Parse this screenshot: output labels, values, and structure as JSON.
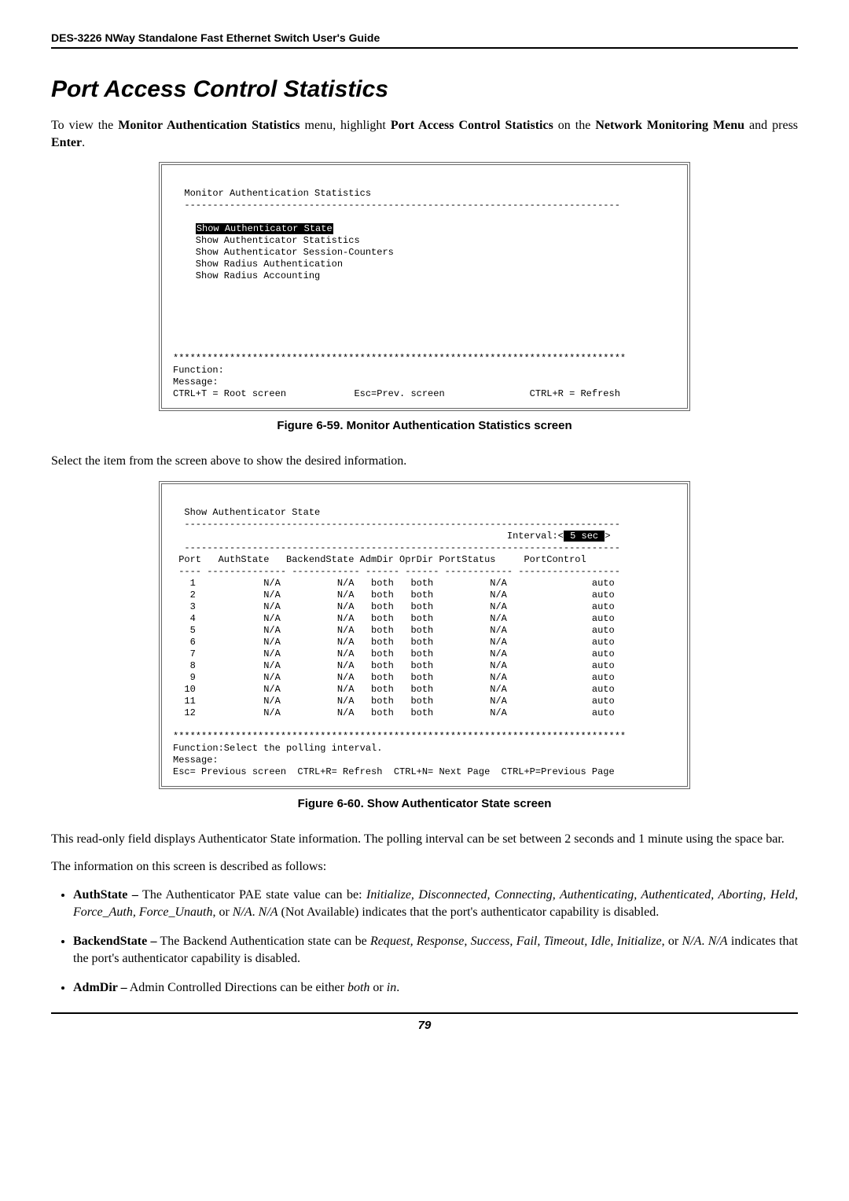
{
  "header": "DES-3226 NWay Standalone Fast Ethernet Switch User's Guide",
  "title": "Port Access Control Statistics",
  "intro": {
    "p1_a": "To view the ",
    "p1_b": "Monitor Authentication Statistics",
    "p1_c": " menu, highlight ",
    "p1_d": "Port Access Control Statistics",
    "p1_e": " on the ",
    "p1_f": "Network Monitoring Menu",
    "p1_g": " and press ",
    "p1_h": "Enter",
    "p1_i": "."
  },
  "term1": {
    "title": "Monitor Authentication Statistics",
    "rule": "  -----------------------------------------------------------------------------",
    "opt1": "Show Authenticator State",
    "opt2": "    Show Authenticator Statistics",
    "opt3": "    Show Authenticator Session-Counters",
    "opt4": "    Show Radius Authentication",
    "opt5": "    Show Radius Accounting",
    "stars": "********************************************************************************",
    "func": "Function:",
    "msg": "Message:",
    "nav": "CTRL+T = Root screen            Esc=Prev. screen               CTRL+R = Refresh"
  },
  "caption1": "Figure 6-59.  Monitor Authentication Statistics screen",
  "mid": "Select the item from the screen above to show the desired information.",
  "term2": {
    "title": "  Show Authenticator State",
    "rule1": "  -----------------------------------------------------------------------------",
    "interval_a": "                                                           Interval:<",
    "interval_b": " 5 sec ",
    "interval_c": ">",
    "rule2": "  -----------------------------------------------------------------------------",
    "hdr": " Port   AuthState   BackendState AdmDir OprDir PortStatus     PortControl",
    "rule3": " ---- -------------- ------------ ------ ------ ------------ ------------------",
    "r1": "   1            N/A          N/A   both   both          N/A               auto",
    "r2": "   2            N/A          N/A   both   both          N/A               auto",
    "r3": "   3            N/A          N/A   both   both          N/A               auto",
    "r4": "   4            N/A          N/A   both   both          N/A               auto",
    "r5": "   5            N/A          N/A   both   both          N/A               auto",
    "r6": "   6            N/A          N/A   both   both          N/A               auto",
    "r7": "   7            N/A          N/A   both   both          N/A               auto",
    "r8": "   8            N/A          N/A   both   both          N/A               auto",
    "r9": "   9            N/A          N/A   both   both          N/A               auto",
    "r10": "  10            N/A          N/A   both   both          N/A               auto",
    "r11": "  11            N/A          N/A   both   both          N/A               auto",
    "r12": "  12            N/A          N/A   both   both          N/A               auto",
    "stars": "********************************************************************************",
    "func": "Function:Select the polling interval.",
    "msg": "Message:",
    "nav": "Esc= Previous screen  CTRL+R= Refresh  CTRL+N= Next Page  CTRL+P=Previous Page"
  },
  "caption2": "Figure 6-60.  Show Authenticator State screen",
  "post": {
    "p1": "This read-only field displays Authenticator State information. The polling interval can be set between 2 seconds and 1 minute using the space bar.",
    "p2": "The information on this screen is described as follows:"
  },
  "bullets": {
    "b1": {
      "lead": "AuthState –",
      "t1": " The Authenticator PAE state value can be: ",
      "vals": "Initialize, Disconnected, Connecting, Authenticating, Authenticated, Aborting, Held, Force_Auth, Force_Unauth",
      "t2": ", or ",
      "na1": "N/A",
      "t3": ". ",
      "na2": "N/A",
      "t4": " (Not Available) indicates that the port's authenticator capability is disabled."
    },
    "b2": {
      "lead": "BackendState –",
      "t1": " The Backend Authentication state can be ",
      "vals": "Request, Response, Success, Fail, Timeout, Idle, Initialize",
      "t2": ", or ",
      "na1": "N/A",
      "t3": ". ",
      "na2": "N/A",
      "t4": " indicates that the port's authenticator capability is disabled."
    },
    "b3": {
      "lead": "AdmDir –",
      "t1": " Admin Controlled Directions can be either ",
      "v1": "both",
      "t2": " or ",
      "v2": "in",
      "t3": "."
    }
  },
  "page_number": "79",
  "chart_data": {
    "type": "table",
    "title": "Show Authenticator State",
    "columns": [
      "Port",
      "AuthState",
      "BackendState",
      "AdmDir",
      "OprDir",
      "PortStatus",
      "PortControl"
    ],
    "rows": [
      [
        1,
        "N/A",
        "N/A",
        "both",
        "both",
        "N/A",
        "auto"
      ],
      [
        2,
        "N/A",
        "N/A",
        "both",
        "both",
        "N/A",
        "auto"
      ],
      [
        3,
        "N/A",
        "N/A",
        "both",
        "both",
        "N/A",
        "auto"
      ],
      [
        4,
        "N/A",
        "N/A",
        "both",
        "both",
        "N/A",
        "auto"
      ],
      [
        5,
        "N/A",
        "N/A",
        "both",
        "both",
        "N/A",
        "auto"
      ],
      [
        6,
        "N/A",
        "N/A",
        "both",
        "both",
        "N/A",
        "auto"
      ],
      [
        7,
        "N/A",
        "N/A",
        "both",
        "both",
        "N/A",
        "auto"
      ],
      [
        8,
        "N/A",
        "N/A",
        "both",
        "both",
        "N/A",
        "auto"
      ],
      [
        9,
        "N/A",
        "N/A",
        "both",
        "both",
        "N/A",
        "auto"
      ],
      [
        10,
        "N/A",
        "N/A",
        "both",
        "both",
        "N/A",
        "auto"
      ],
      [
        11,
        "N/A",
        "N/A",
        "both",
        "both",
        "N/A",
        "auto"
      ],
      [
        12,
        "N/A",
        "N/A",
        "both",
        "both",
        "N/A",
        "auto"
      ]
    ],
    "interval": "5 sec"
  }
}
